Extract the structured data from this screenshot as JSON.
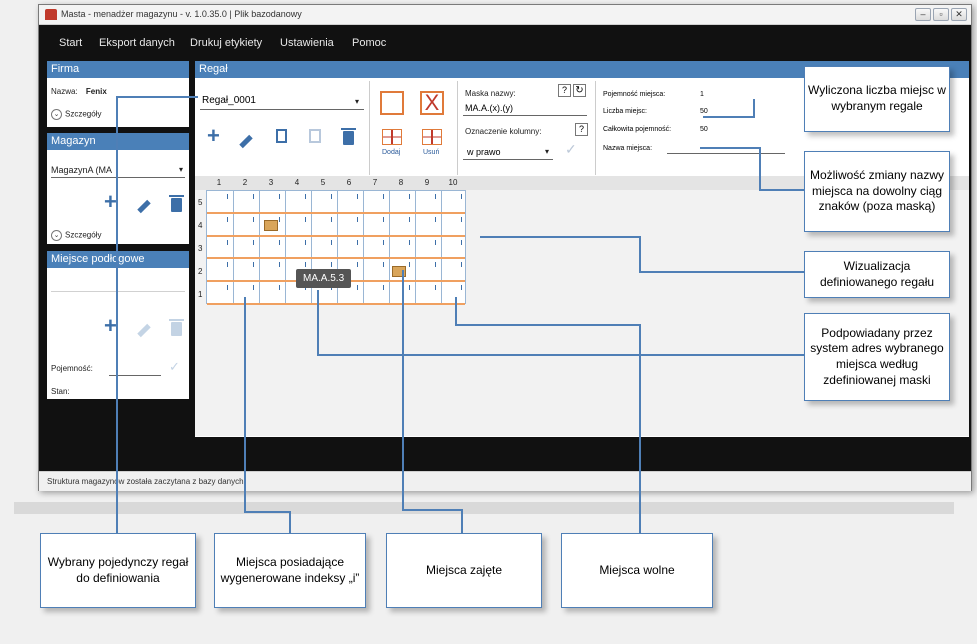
{
  "window": {
    "title": "Masta - menadżer magazynu - v. 1.0.35.0 | Plik bazodanowy",
    "controls": [
      "‒",
      "▫",
      "✕"
    ]
  },
  "menu": [
    "Start",
    "Eksport danych",
    "Drukuj etykiety",
    "Ustawienia",
    "Pomoc"
  ],
  "firma": {
    "header": "Firma",
    "name_label": "Nazwa:",
    "name_value": "Fenix",
    "details": "Szczegóły"
  },
  "magazyn": {
    "header": "Magazyn",
    "selected": "MagazynA (MA",
    "details": "Szczegóły"
  },
  "miejsce": {
    "header": "Miejsce podłogowe",
    "capacity_label": "Pojemność:",
    "state_label": "Stan:"
  },
  "regal": {
    "header": "Regał",
    "selected": "Regał_0001",
    "add_label": "Dodaj",
    "remove_label": "Usuń",
    "mask_label": "Maska nazwy:",
    "mask_value": "MA.A.(x).(y)",
    "column_label": "Oznaczenie kolumny:",
    "column_value": "w prawo",
    "help": "?",
    "capacity_place_label": "Pojemność miejsca:",
    "capacity_place_value": "1",
    "places_count_label": "Liczba miejsc:",
    "places_count_value": "50",
    "total_capacity_label": "Całkowita pojemność:",
    "total_capacity_value": "50",
    "place_name_label": "Nazwa miejsca:",
    "columns": [
      "1",
      "2",
      "3",
      "4",
      "5",
      "6",
      "7",
      "8",
      "9",
      "10"
    ],
    "rows": [
      "5",
      "4",
      "3",
      "2",
      "1"
    ],
    "slot_marker": "i",
    "tooltip": "MA.A.5.3"
  },
  "status": "Struktura magazynów została zaczytana z bazy danych.",
  "callouts": {
    "wyliczona": "Wyliczona liczba miejsc w wybranym regale",
    "zmiana": "Możliwość zmiany nazwy miejsca na dowolny ciąg znaków (poza maską)",
    "wizualizacja": "Wizualizacja definiowanego regału",
    "podpowiadany": "Podpowiadany przez system adres wybranego miejsca według zdefiniowanej maski",
    "pojedynczy": "Wybrany pojedynczy regał do definiowania",
    "indeksy": "Miejsca posiadające wygenerowane indeksy „i”",
    "zajete": "Miejsca zajęte",
    "wolne": "Miejsca wolne"
  },
  "colors": {
    "header_blue": "#4a80b8",
    "menu_bg": "#111111",
    "callout_border": "#4f7fb6",
    "shelf_orange": "#f0a060"
  }
}
